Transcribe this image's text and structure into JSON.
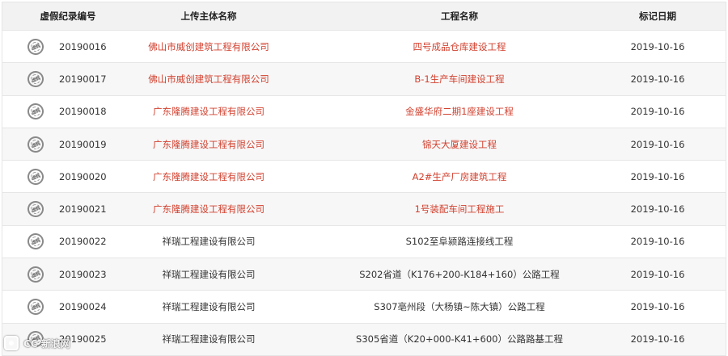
{
  "table": {
    "headers": {
      "id": "虚假纪录编号",
      "org": "上传主体名称",
      "project": "工程名称",
      "date": "标记日期"
    },
    "stamp_text": "虚假",
    "rows": [
      {
        "id": "20190016",
        "org": "佛山市威创建筑工程有限公司",
        "project": "四号成品仓库建设工程",
        "date": "2019-10-16",
        "highlight": true
      },
      {
        "id": "20190017",
        "org": "佛山市威创建筑工程有限公司",
        "project": "B-1生产车间建设工程",
        "date": "2019-10-16",
        "highlight": true
      },
      {
        "id": "20190018",
        "org": "广东隆腾建设工程有限公司",
        "project": "金盛华府二期1座建设工程",
        "date": "2019-10-16",
        "highlight": true
      },
      {
        "id": "20190019",
        "org": "广东隆腾建设工程有限公司",
        "project": "锦天大厦建设工程",
        "date": "2019-10-16",
        "highlight": true
      },
      {
        "id": "20190020",
        "org": "广东隆腾建设工程有限公司",
        "project": "A2#生产厂房建筑工程",
        "date": "2019-10-16",
        "highlight": true
      },
      {
        "id": "20190021",
        "org": "广东隆腾建设工程有限公司",
        "project": "1号装配车间工程施工",
        "date": "2019-10-16",
        "highlight": true
      },
      {
        "id": "20190022",
        "org": "祥瑞工程建设有限公司",
        "project": "S102至阜颍路连接线工程",
        "date": "2019-10-16",
        "highlight": false
      },
      {
        "id": "20190023",
        "org": "祥瑞工程建设有限公司",
        "project": "S202省道（K176+200-K184+160）公路工程",
        "date": "2019-10-16",
        "highlight": false
      },
      {
        "id": "20190024",
        "org": "祥瑞工程建设有限公司",
        "project": "S307亳州段（大杨镇~陈大镇）公路工程",
        "date": "2019-10-16",
        "highlight": false
      },
      {
        "id": "20190025",
        "org": "祥瑞工程建设有限公司",
        "project": "S305省道（K20+000-K41+600）公路路基工程",
        "date": "2019-10-16",
        "highlight": false
      }
    ]
  },
  "watermark": {
    "text": "CC 新浪网"
  }
}
